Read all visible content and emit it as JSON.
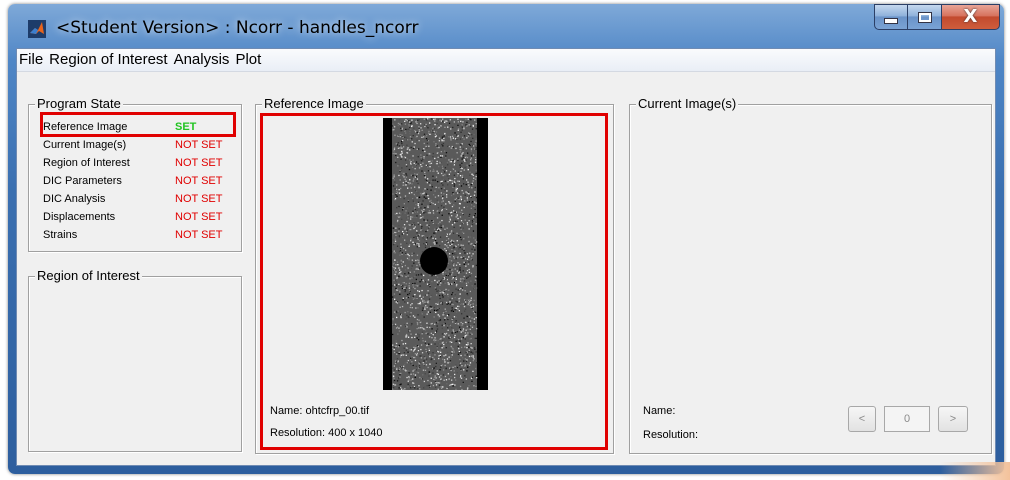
{
  "window": {
    "title": "<Student Version> : Ncorr - handles_ncorr",
    "close_glyph": "X",
    "app_icon": "matlab-icon"
  },
  "menu": [
    "File",
    "Region of Interest",
    "Analysis",
    "Plot"
  ],
  "program_state": {
    "title": "Program State",
    "rows": [
      {
        "label": "Reference Image",
        "value": "SET",
        "status": "set"
      },
      {
        "label": "Current Image(s)",
        "value": "NOT SET",
        "status": "not-set"
      },
      {
        "label": "Region of Interest",
        "value": "NOT SET",
        "status": "not-set"
      },
      {
        "label": "DIC Parameters",
        "value": "NOT SET",
        "status": "not-set"
      },
      {
        "label": "DIC Analysis",
        "value": "NOT SET",
        "status": "not-set"
      },
      {
        "label": "Displacements",
        "value": "NOT SET",
        "status": "not-set"
      },
      {
        "label": "Strains",
        "value": "NOT SET",
        "status": "not-set"
      }
    ]
  },
  "roi_panel": {
    "title": "Region of Interest"
  },
  "reference_panel": {
    "title": "Reference Image",
    "name_text": "Name: ohtcfrp_00.tif",
    "resolution_text": "Resolution: 400 x 1040"
  },
  "current_panel": {
    "title": "Current Image(s)",
    "name_text": "Name:",
    "resolution_text": "Resolution:",
    "prev_label": "<",
    "index_value": "0",
    "next_label": ">"
  },
  "colors": {
    "highlight": "#e00000",
    "set": "#22c422",
    "not_set": "#e00000"
  }
}
